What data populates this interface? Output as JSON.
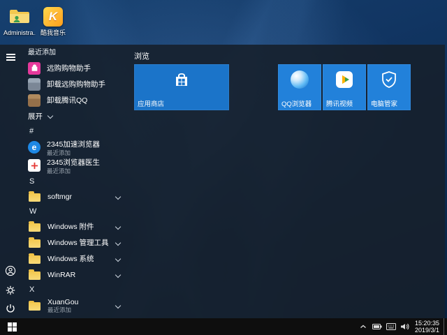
{
  "desktop": {
    "icons": [
      {
        "label": "Administra...",
        "icon": "user-folder-icon"
      },
      {
        "label": "酷我音乐",
        "icon": "kuwo-music-icon"
      }
    ]
  },
  "start_menu": {
    "recent_header": "最近添加",
    "recent": [
      {
        "label": "远购购物助手",
        "icon": "shopping-assistant-icon"
      },
      {
        "label": "卸载远购购物助手",
        "icon": "uninstaller-icon"
      },
      {
        "label": "卸载腾讯QQ",
        "icon": "uninstaller-icon"
      }
    ],
    "expand_label": "展开",
    "sections": {
      "hash": {
        "letter": "#",
        "items": [
          {
            "label": "2345加速浏览器",
            "sub": "最近添加",
            "icon": "browser-2345-icon"
          },
          {
            "label": "2345浏览器医生",
            "sub": "最近添加",
            "icon": "doctor-2345-icon"
          }
        ]
      },
      "s": {
        "letter": "S",
        "items": [
          {
            "label": "softmgr",
            "icon": "folder-icon"
          }
        ]
      },
      "w": {
        "letter": "W",
        "items": [
          {
            "label": "Windows 附件",
            "icon": "folder-icon"
          },
          {
            "label": "Windows 管理工具",
            "icon": "folder-icon"
          },
          {
            "label": "Windows 系统",
            "icon": "folder-icon"
          },
          {
            "label": "WinRAR",
            "icon": "folder-icon"
          }
        ]
      },
      "x": {
        "letter": "X",
        "items": [
          {
            "label": "XuanGou",
            "sub": "最近添加",
            "icon": "folder-icon"
          }
        ]
      }
    },
    "tiles": {
      "group_header": "浏览",
      "store": {
        "label": "应用商店",
        "icon": "store-icon"
      },
      "small": [
        {
          "label": "QQ浏览器",
          "icon": "qq-browser-icon"
        },
        {
          "label": "腾讯视频",
          "icon": "tencent-video-icon"
        },
        {
          "label": "电脑管家",
          "icon": "pc-manager-icon"
        }
      ]
    }
  },
  "taskbar": {
    "time": "15:20:35",
    "date": "2019/3/1"
  },
  "colors": {
    "tile_blue": "#2281da",
    "tile_blue_dark": "#1b74c9",
    "taskbar_bg": "#0e0e0e",
    "menu_bg": "rgba(22,32,44,0.9)",
    "wallpaper_blue": "#113562",
    "accent_pink": "#e5399b"
  }
}
